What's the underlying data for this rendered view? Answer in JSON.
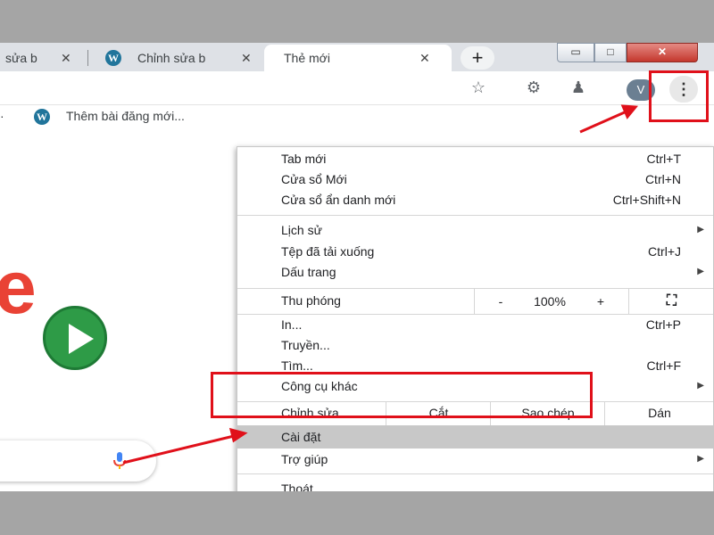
{
  "tabs": [
    {
      "title": "sửa b",
      "close": "✕"
    },
    {
      "title": "Chỉnh sửa b",
      "close": "✕"
    },
    {
      "title": "Thẻ mới",
      "close": "✕"
    }
  ],
  "new_tab": "+",
  "window_controls": {
    "minimize": "▭",
    "maximize": "□",
    "close": "✕"
  },
  "toolbar": {
    "star_icon": "☆",
    "ext1_icon": "⚙",
    "ext2_icon": "♟",
    "avatar": "V",
    "menu_icon": "⋮"
  },
  "bookmarks": {
    "item": "Thêm bài đăng mới..."
  },
  "menu": {
    "new_tab": {
      "label": "Tab mới",
      "shortcut": "Ctrl+T"
    },
    "new_window": {
      "label": "Cửa sổ Mới",
      "shortcut": "Ctrl+N"
    },
    "incognito": {
      "label": "Cửa sổ ẩn danh mới",
      "shortcut": "Ctrl+Shift+N"
    },
    "history": {
      "label": "Lịch sử"
    },
    "downloads": {
      "label": "Tệp đã tải xuống",
      "shortcut": "Ctrl+J"
    },
    "bookmarks": {
      "label": "Dấu trang"
    },
    "zoom": {
      "label": "Thu phóng",
      "minus": "-",
      "value": "100%",
      "plus": "+",
      "fullscreen": "⛶"
    },
    "print": {
      "label": "In...",
      "shortcut": "Ctrl+P"
    },
    "cast": {
      "label": "Truyền..."
    },
    "find": {
      "label": "Tìm...",
      "shortcut": "Ctrl+F"
    },
    "more_tools": {
      "label": "Công cụ khác"
    },
    "edit": {
      "label": "Chỉnh sửa",
      "cut": "Cắt",
      "copy": "Sao chép",
      "paste": "Dán"
    },
    "settings": {
      "label": "Cài đặt"
    },
    "help": {
      "label": "Trợ giúp"
    },
    "exit": {
      "label": "Thoát"
    },
    "submenu_arrow": "▶"
  },
  "colors": {
    "highlight": "#e0101a",
    "wordpress": "#21759b"
  }
}
